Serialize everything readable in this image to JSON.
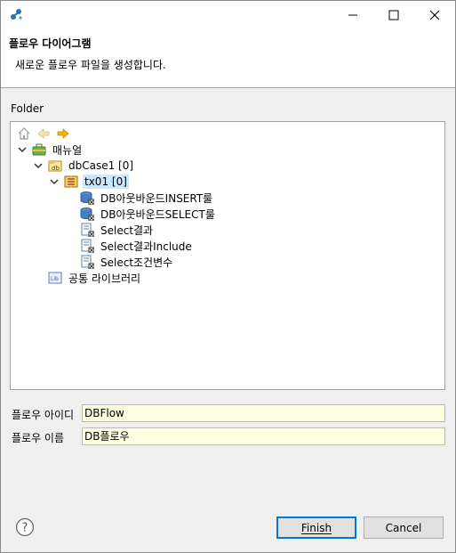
{
  "window": {
    "minimize_glyph": "—",
    "maximize_glyph": "☐",
    "close_glyph": "✕"
  },
  "header": {
    "title": "플로우 다이어그램",
    "message": "새로운 플로우 파일을 생성합니다."
  },
  "folder": {
    "label": "Folder",
    "tree": [
      {
        "label": "매뉴얼",
        "icon": "briefcase-icon",
        "expanded": true,
        "level": 0
      },
      {
        "label": "dbCase1 [0]",
        "icon": "package-icon",
        "expanded": true,
        "level": 1
      },
      {
        "label": "tx01 [0]",
        "icon": "transaction-icon",
        "expanded": true,
        "level": 2,
        "selected": true
      },
      {
        "label": "DB아웃바운드INSERT룰",
        "icon": "database-icon",
        "level": 3
      },
      {
        "label": "DB아웃바운드SELECT룰",
        "icon": "database-icon",
        "level": 3
      },
      {
        "label": "Select결과",
        "icon": "document-icon",
        "level": 3
      },
      {
        "label": "Select결과Include",
        "icon": "document-icon",
        "level": 3
      },
      {
        "label": "Select조건변수",
        "icon": "document-icon",
        "level": 3
      },
      {
        "label": "공통 라이브러리",
        "icon": "library-icon",
        "level": 1
      }
    ]
  },
  "form": {
    "flow_id_label": "플로우 아이디",
    "flow_id_value": "DBFlow",
    "flow_name_label": "플로우 이름",
    "flow_name_value": "DB플로우"
  },
  "buttons": {
    "finish": "Finish",
    "cancel": "Cancel"
  },
  "colors": {
    "selection": "#cce8ff",
    "field_background": "#ffffe1",
    "primary_border": "#0078d7"
  }
}
